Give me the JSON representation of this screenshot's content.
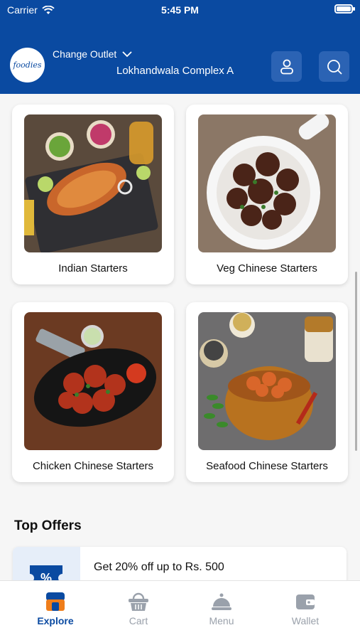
{
  "status_bar": {
    "carrier": "Carrier",
    "time": "5:45 PM"
  },
  "header": {
    "logo_text": "foodies",
    "change_outlet_label": "Change Outlet",
    "outlet_name": "Lokhandwala Complex A"
  },
  "categories": [
    {
      "label": "Indian Starters"
    },
    {
      "label": "Veg Chinese Starters"
    },
    {
      "label": "Chicken Chinese Starters"
    },
    {
      "label": "Seafood Chinese Starters"
    }
  ],
  "top_offers": {
    "title": "Top Offers",
    "offers": [
      {
        "text": "Get 20% off up to Rs. 500"
      }
    ]
  },
  "tabs": [
    {
      "label": "Explore",
      "active": true
    },
    {
      "label": "Cart",
      "active": false
    },
    {
      "label": "Menu",
      "active": false
    },
    {
      "label": "Wallet",
      "active": false
    }
  ],
  "colors": {
    "primary": "#0a4aa1",
    "button_bg": "#2b63b4",
    "inactive_tab": "#9aa1ab",
    "accent_orange": "#ef7d1a"
  }
}
